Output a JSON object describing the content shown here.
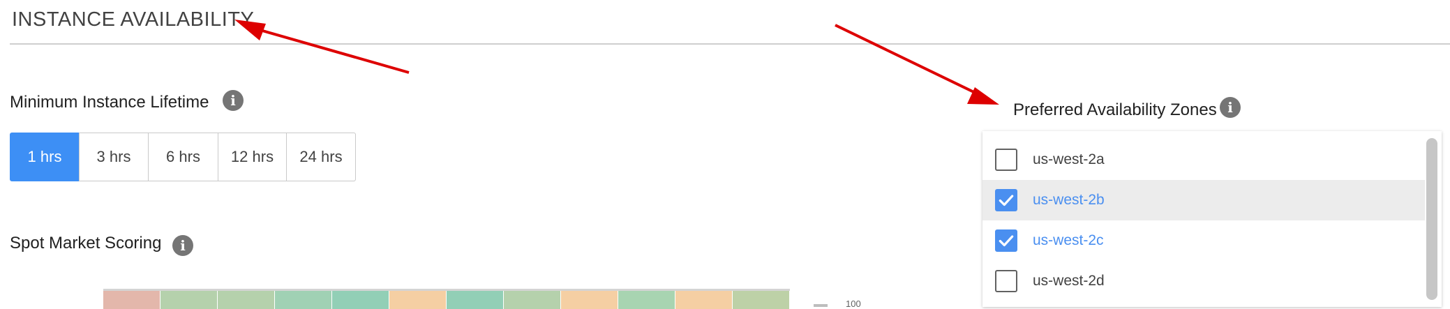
{
  "section": {
    "title": "INSTANCE AVAILABILITY"
  },
  "lifetime": {
    "label": "Minimum Instance Lifetime",
    "options": [
      "1 hrs",
      "3 hrs",
      "6 hrs",
      "12 hrs",
      "24 hrs"
    ],
    "selected": "1 hrs"
  },
  "zones": {
    "label": "Preferred Availability Zones",
    "items": [
      {
        "label": "us-west-2a",
        "checked": false
      },
      {
        "label": "us-west-2b",
        "checked": true
      },
      {
        "label": "us-west-2c",
        "checked": true
      },
      {
        "label": "us-west-2d",
        "checked": false
      }
    ]
  },
  "scoring": {
    "label": "Spot Market Scoring",
    "cell_colors": [
      "#e3b7ab",
      "#b5d1ac",
      "#b5d1ac",
      "#a0d1b4",
      "#92cfb6",
      "#f5cfa3",
      "#92cfb6",
      "#b5d1ac",
      "#f5cfa3",
      "#a8d4b1",
      "#f5cfa3",
      "#bdd1a7"
    ],
    "legend_tick": "100"
  },
  "colors": {
    "accent": "#3d8ff5",
    "annotation_arrow": "#dd0000"
  },
  "icons": {
    "info": "info-icon",
    "check": "check-icon"
  }
}
